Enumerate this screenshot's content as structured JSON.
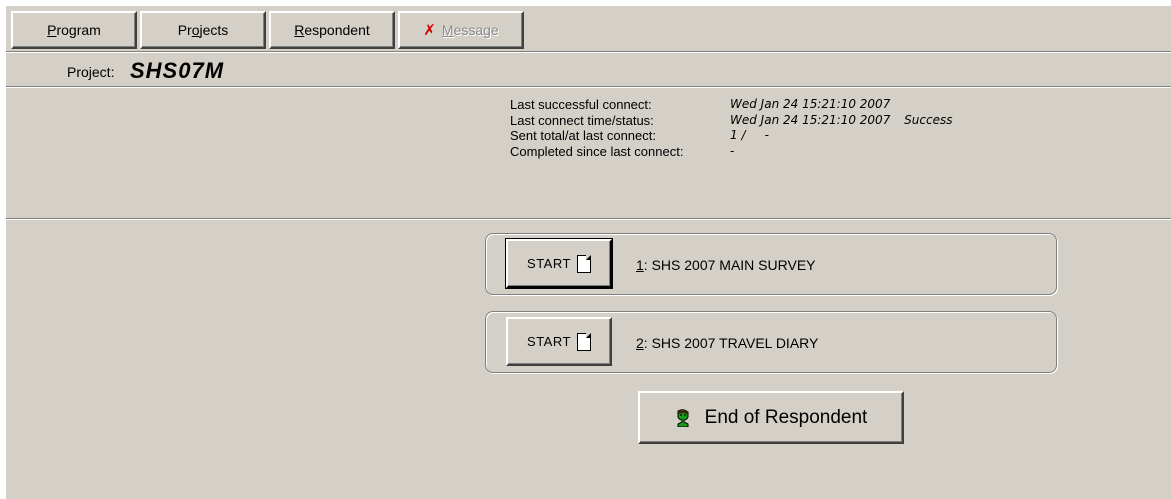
{
  "toolbar": {
    "program_label": "Program",
    "projects_label": "Projects",
    "respondent_label": "Respondent",
    "message_label": "Message"
  },
  "project": {
    "label": "Project:",
    "value": "SHS07M"
  },
  "info": {
    "last_successful_label": "Last successful connect:",
    "last_successful_value": "Wed Jan 24 15:21:10 2007",
    "last_connect_label": "Last connect time/status:",
    "last_connect_value": "Wed Jan 24 15:21:10 2007",
    "last_connect_status": "Success",
    "sent_label": "Sent total/at last connect:",
    "sent_value": "1 /     -",
    "completed_label": "Completed since last connect:",
    "completed_value": "-"
  },
  "surveys": [
    {
      "start_label": "START",
      "number": "1",
      "title": ": SHS 2007 MAIN SURVEY"
    },
    {
      "start_label": "START",
      "number": "2",
      "title": ": SHS 2007 TRAVEL DIARY"
    }
  ],
  "end_button": {
    "label": "End of Respondent"
  },
  "colors": {
    "background": "#d4d0c8",
    "message_icon": "#d40000",
    "person_icon": "#1a9a1a"
  },
  "icons": {
    "message": "x-icon",
    "start": "document-icon",
    "end": "person-icon"
  }
}
